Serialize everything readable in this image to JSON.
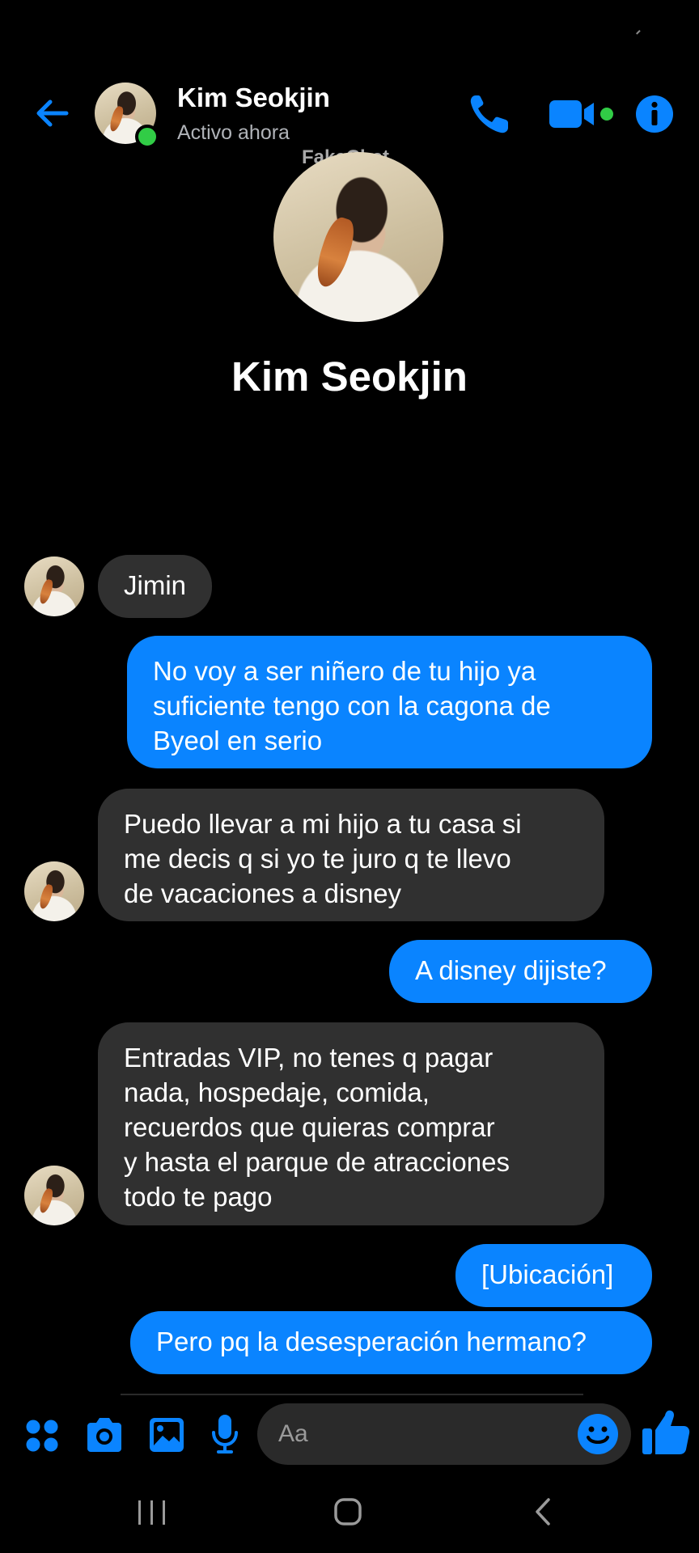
{
  "header": {
    "contact_name": "Kim Seokjin",
    "status": "Activo ahora",
    "online": true
  },
  "watermark": "FakeChat",
  "profile": {
    "name": "Kim Seokjin"
  },
  "messages": [
    {
      "direction": "incoming",
      "lines": [
        "Jimin"
      ]
    },
    {
      "direction": "outgoing",
      "lines": [
        "No voy a ser niñero de tu hijo ya",
        "suficiente tengo con la cagona de",
        "Byeol en serio"
      ]
    },
    {
      "direction": "incoming",
      "lines": [
        "Puedo llevar a mi hijo a tu casa si",
        "me decis q si yo te juro q te llevo",
        "de vacaciones a disney"
      ]
    },
    {
      "direction": "outgoing",
      "lines": [
        "A disney dijiste?"
      ]
    },
    {
      "direction": "incoming",
      "lines": [
        "Entradas VIP, no tenes q pagar",
        "nada, hospedaje, comida,",
        "recuerdos que quieras comprar",
        "y hasta el parque de atracciones",
        "todo te pago"
      ]
    },
    {
      "direction": "outgoing",
      "lines": [
        "[Ubicación]"
      ]
    },
    {
      "direction": "outgoing",
      "lines": [
        "Pero pq la desesperación hermano?"
      ]
    }
  ],
  "composer": {
    "placeholder": "Aa"
  },
  "icons": {
    "back": "arrow-left-icon",
    "call": "phone-icon",
    "video": "video-camera-icon",
    "info": "info-icon",
    "apps": "apps-grid-icon",
    "camera": "camera-icon",
    "gallery": "image-icon",
    "mic": "microphone-icon",
    "emoji": "smiley-icon",
    "like": "thumbs-up-icon"
  },
  "colors": {
    "accent": "#0a84ff",
    "background": "#000000",
    "incoming_bubble": "#303030",
    "online": "#31cc46",
    "secondary_text": "#b0b3b8"
  }
}
